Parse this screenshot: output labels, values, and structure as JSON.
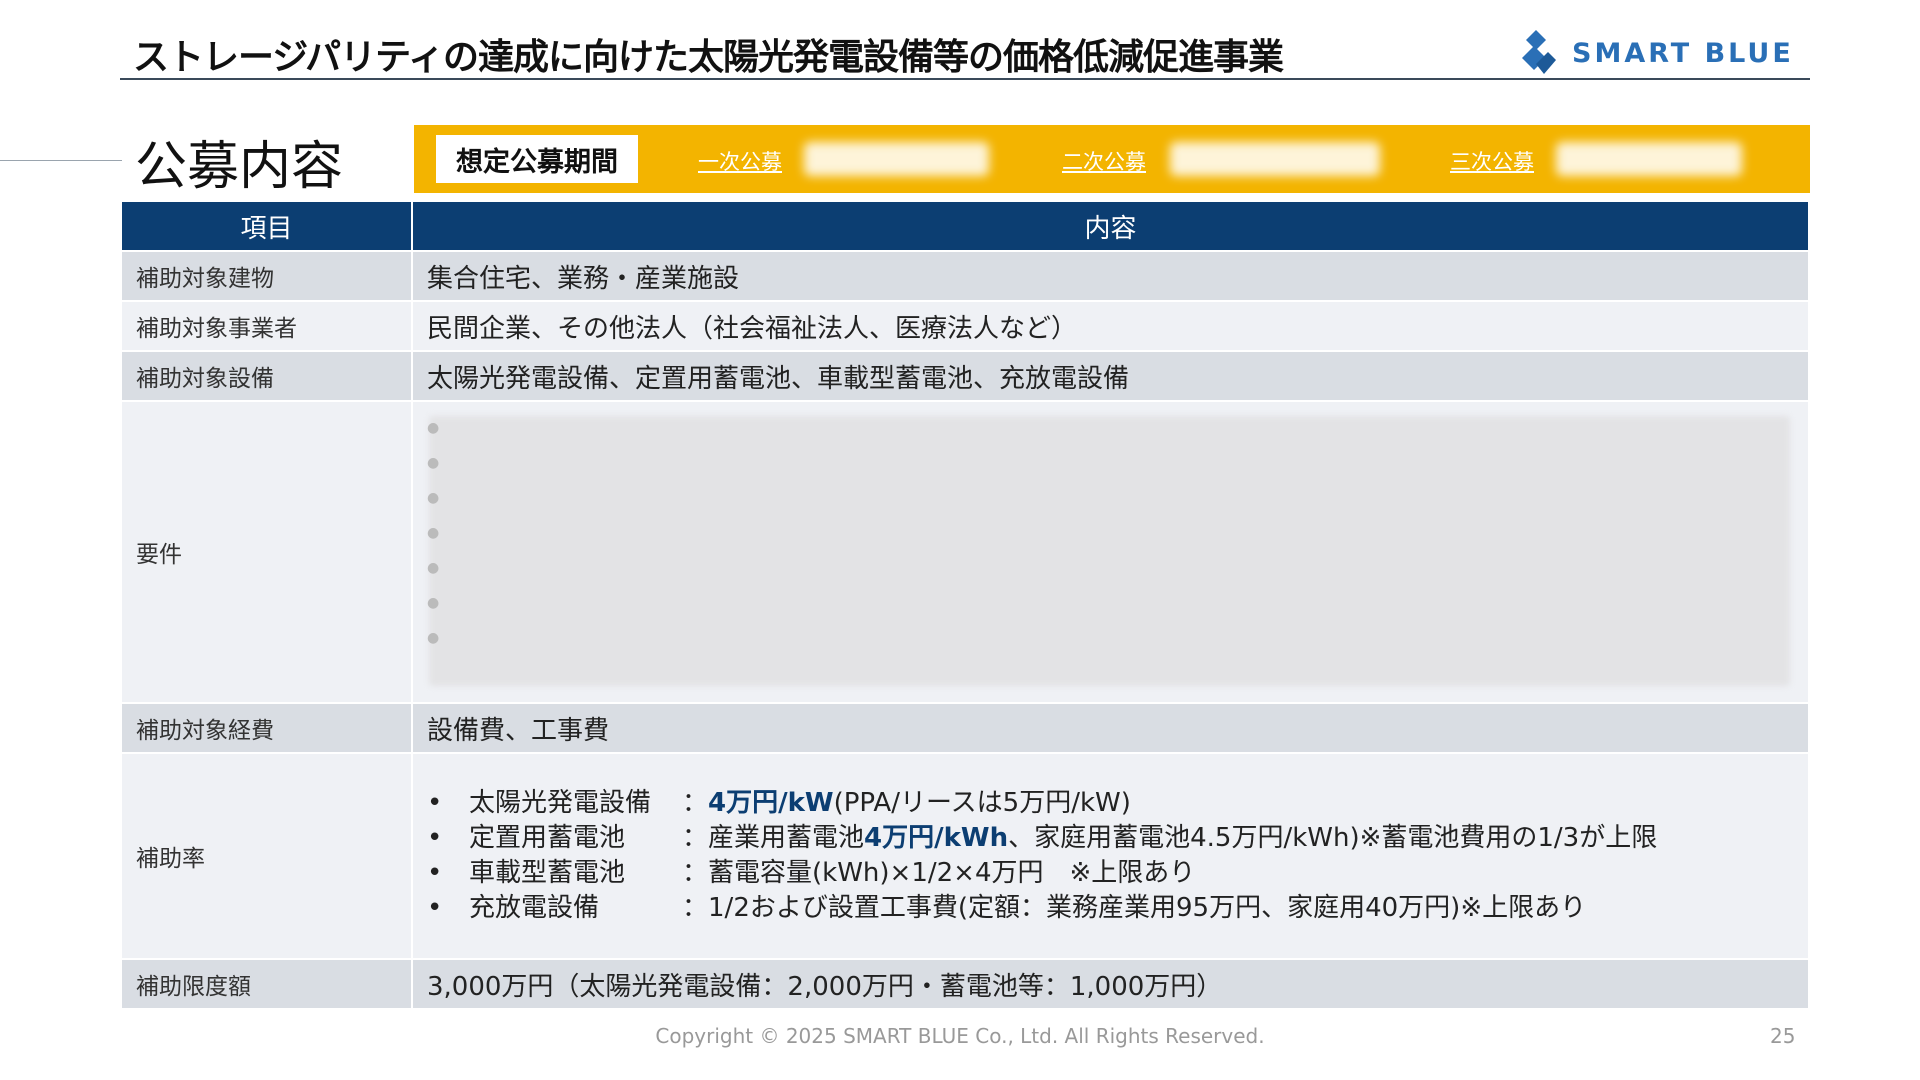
{
  "header": {
    "title": "ストレージパリティの達成に向けた太陽光発電設備等の価格低減促進事業",
    "logo_text": "SMART BLUE"
  },
  "section_title": "公募内容",
  "period": {
    "label": "想定公募期間",
    "rounds": [
      "一次公募",
      "二次公募",
      "三次公募"
    ]
  },
  "table": {
    "headers": [
      "項目",
      "内容"
    ],
    "rows": [
      {
        "label": "補助対象建物",
        "value": "集合住宅、業務・産業施設"
      },
      {
        "label": "補助対象事業者",
        "value": "民間企業、その他法人（社会福祉法人、医療法人など）"
      },
      {
        "label": "補助対象設備",
        "value": "太陽光発電設備、定置用蓄電池、車載型蓄電池、充放電設備"
      },
      {
        "label": "要件",
        "value": ""
      },
      {
        "label": "補助対象経費",
        "value": "設備費、工事費"
      },
      {
        "label": "補助率",
        "value": ""
      },
      {
        "label": "補助限度額",
        "value": "3,000万円（太陽光発電設備：2,000万円・蓄電池等：1,000万円）"
      }
    ],
    "rates": [
      {
        "name": "太陽光発電設備",
        "sep": "：",
        "hl": "4万円/kW",
        "rest": "(PPA/リースは5万円/kW)"
      },
      {
        "name": "定置用蓄電池",
        "sep": "：産業用蓄電池",
        "hl": "4万円/kWh",
        "rest": "、家庭用蓄電池4.5万円/kWh)※蓄電池費用の1/3が上限"
      },
      {
        "name": "車載型蓄電池",
        "sep": "：",
        "hl": "",
        "rest": "蓄電容量(kWh)×1/2×4万円　※上限あり"
      },
      {
        "name": "充放電設備",
        "sep": "：",
        "hl": "",
        "rest": "1/2および設置工事費(定額：業務産業用95万円、家庭用40万円)※上限あり"
      }
    ]
  },
  "footer": {
    "copyright": "Copyright © 2025 SMART BLUE Co., Ltd. All Rights Reserved.",
    "page": "25"
  },
  "colors": {
    "navy": "#0c3e72",
    "accent": "#f3b400",
    "logo": "#2a6fb6"
  }
}
